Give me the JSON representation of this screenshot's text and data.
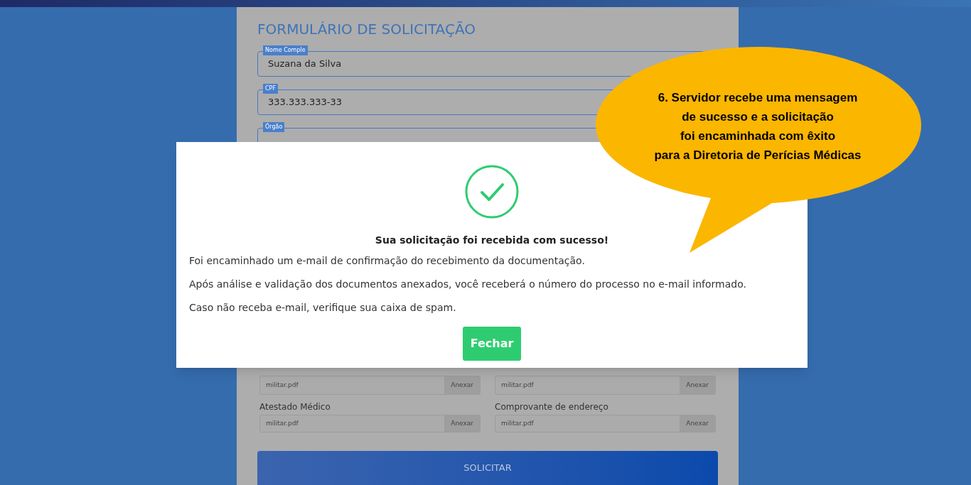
{
  "form": {
    "title": "FORMULÁRIO DE SOLICITAÇÃO",
    "fields": [
      {
        "label": "Nome Comple",
        "value": "Suzana da Silva"
      },
      {
        "label": "CPF",
        "value": "333.333.333-33"
      },
      {
        "label": "Órgão"
      }
    ],
    "attachments": [
      {
        "file": "militar.pdf",
        "button": "Anexar"
      },
      {
        "file": "militar.pdf",
        "button": "Anexar"
      },
      {
        "label": "Atestado Médico",
        "file": "militar.pdf",
        "button": "Anexar"
      },
      {
        "label": "Comprovante de endereço",
        "file": "militar.pdf",
        "button": "Anexar"
      }
    ],
    "submit": "SOLICITAR"
  },
  "modal": {
    "title": "Sua solicitação foi recebida com sucesso!",
    "paragraphs": [
      "Foi encaminhado um e-mail de confirmação do recebimento da documentação.",
      "Após análise e validação dos documentos anexados, você receberá o número do processo no e-mail informado.",
      "Caso não receba e-mail, verifique sua caixa de spam."
    ],
    "button": "Fechar"
  },
  "callout": {
    "lines": [
      "6. Servidor recebe uma mensagem",
      "de sucesso e a solicitação",
      "foi encaminhada com êxito",
      "para a Diretoria de Perícias Médicas"
    ]
  }
}
